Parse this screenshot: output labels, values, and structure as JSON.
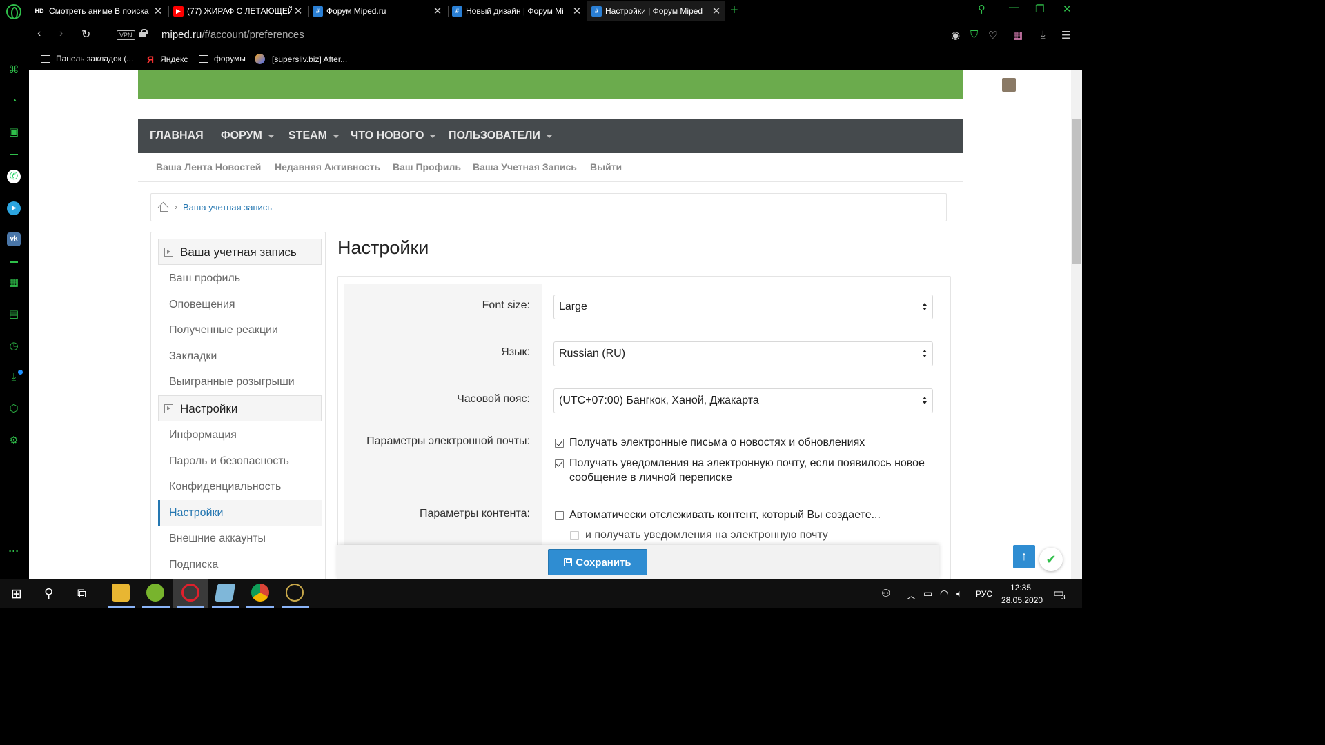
{
  "tabs": [
    {
      "icon": "HD",
      "title": "Смотреть аниме В поиска",
      "active": false
    },
    {
      "icon": "youtube",
      "title": "(77) ЖИРАФ С ЛЕТАЮЩЕЙ",
      "active": false
    },
    {
      "icon": "miped",
      "title": "Форум Miped.ru",
      "active": false
    },
    {
      "icon": "miped",
      "title": "Новый дизайн | Форум Mi",
      "active": false
    },
    {
      "icon": "miped",
      "title": "Настройки | Форум Miped",
      "active": true
    }
  ],
  "address": {
    "vpn": "VPN",
    "host": "miped.ru",
    "path": "/f/account/preferences"
  },
  "bookmarks": [
    {
      "type": "folder",
      "label": "Панель закладок (..."
    },
    {
      "type": "yandex",
      "label": "Яндекс"
    },
    {
      "type": "folder",
      "label": "форумы"
    },
    {
      "type": "site",
      "label": "[supersliv.biz] After..."
    }
  ],
  "mainnav": [
    {
      "label": "ГЛАВНАЯ",
      "dropdown": false
    },
    {
      "label": "ФОРУМ",
      "dropdown": true
    },
    {
      "label": "STEAM",
      "dropdown": true
    },
    {
      "label": "ЧТО НОВОГО",
      "dropdown": true
    },
    {
      "label": "ПОЛЬЗОВАТЕЛИ",
      "dropdown": true
    }
  ],
  "subnav": [
    "Ваша Лента Новостей",
    "Недавняя Активность",
    "Ваш Профиль",
    "Ваша Учетная Запись",
    "Выйти"
  ],
  "breadcrumb": "Ваша учетная запись",
  "leftmenu": {
    "account_header": "Ваша учетная запись",
    "account_items": [
      "Ваш профиль",
      "Оповещения",
      "Полученные реакции",
      "Закладки",
      "Выигранные розыгрыши"
    ],
    "settings_header": "Настройки",
    "settings_items": [
      "Информация",
      "Пароль и безопасность",
      "Конфиденциальность",
      "Настройки",
      "Внешние аккаунты",
      "Подписка"
    ],
    "selected": "Настройки"
  },
  "page_title": "Настройки",
  "form": {
    "font_size": {
      "label": "Font size:",
      "value": "Large"
    },
    "language": {
      "label": "Язык:",
      "value": "Russian (RU)"
    },
    "timezone": {
      "label": "Часовой пояс:",
      "value": "(UTC+07:00) Бангкок, Ханой, Джакарта"
    },
    "email_options": {
      "label": "Параметры электронной почты:",
      "news": {
        "text": "Получать электронные письма о новостях и обновлениях",
        "checked": true
      },
      "pm": {
        "text": "Получать уведомления на электронную почту, если появилось новое сообщение в личной переписке",
        "checked": true
      }
    },
    "content_options": {
      "label": "Параметры контента:",
      "watch": {
        "text": "Автоматически отслеживать контент, который Вы создаете...",
        "checked": false
      },
      "watch_email": {
        "text": "и получать уведомления на электронную почту",
        "checked": false
      }
    }
  },
  "save_label": "Сохранить",
  "taskbar": {
    "lang": "РУС",
    "time": "12:35",
    "date": "28.05.2020",
    "notifications": "3"
  },
  "colors": {
    "brand_green": "#6bab4d",
    "nav_dark": "#454a4d",
    "link_blue": "#2577b1",
    "button_blue": "#2f8dd2",
    "opera_green": "#2fbf4a"
  }
}
